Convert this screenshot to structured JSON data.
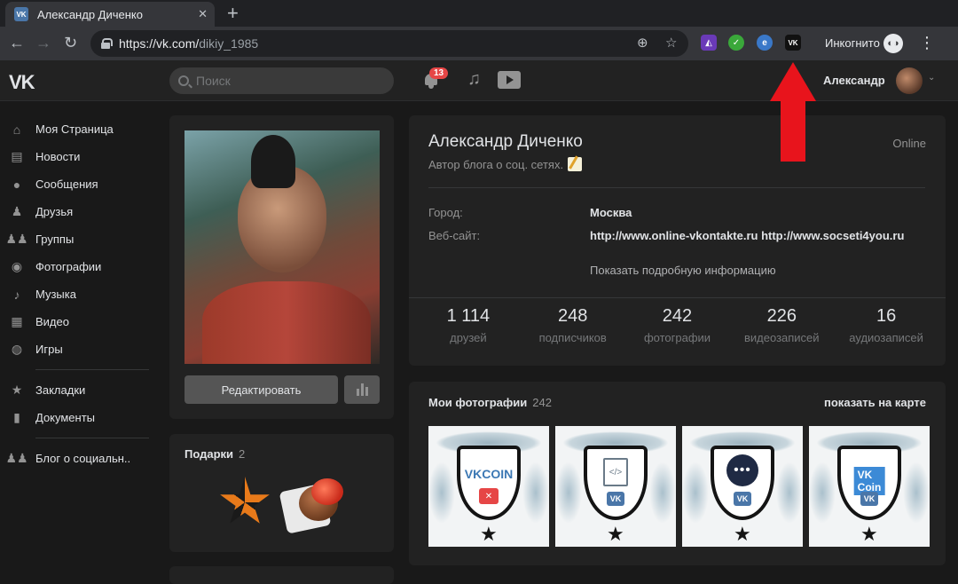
{
  "browser": {
    "tab_title": "Александр Диченко",
    "tab_favicon": "VK",
    "url_host": "https://vk.com/",
    "url_path": "dikiy_1985",
    "incognito_label": "Инкогнито",
    "extension_vk_label": "VK",
    "icons": [
      "back-icon",
      "forward-icon",
      "reload-icon",
      "lock-icon",
      "zoom-icon",
      "star-icon",
      "incognito-icon",
      "menu-icon"
    ]
  },
  "header": {
    "logo": "VK",
    "search_placeholder": "Поиск",
    "notification_count": "13",
    "user_name": "Александр"
  },
  "sidebar": {
    "items": [
      {
        "label": "Моя Страница",
        "icon": "home-icon"
      },
      {
        "label": "Новости",
        "icon": "news-icon"
      },
      {
        "label": "Сообщения",
        "icon": "messages-icon"
      },
      {
        "label": "Друзья",
        "icon": "friends-icon"
      },
      {
        "label": "Группы",
        "icon": "groups-icon"
      },
      {
        "label": "Фотографии",
        "icon": "camera-icon"
      },
      {
        "label": "Музыка",
        "icon": "music-icon"
      },
      {
        "label": "Видео",
        "icon": "video-icon"
      },
      {
        "label": "Игры",
        "icon": "gamepad-icon"
      }
    ],
    "items2": [
      {
        "label": "Закладки",
        "icon": "bookmark-icon"
      },
      {
        "label": "Документы",
        "icon": "document-icon"
      }
    ],
    "items3": [
      {
        "label": "Блог о социальн..",
        "icon": "community-icon"
      }
    ]
  },
  "profile": {
    "edit_button": "Редактировать",
    "name": "Александр Диченко",
    "status": "Автор блога о соц. сетях.",
    "online": "Online",
    "city_label": "Город:",
    "city_value": "Москва",
    "website_label": "Веб-сайт:",
    "website_value": "http://www.online-vkontakte.ru http://www.socseti4you.ru",
    "more_info": "Показать подробную информацию",
    "counters": [
      {
        "num": "1 114",
        "label": "друзей"
      },
      {
        "num": "248",
        "label": "подписчиков"
      },
      {
        "num": "242",
        "label": "фотографии"
      },
      {
        "num": "226",
        "label": "видеозаписей"
      },
      {
        "num": "16",
        "label": "аудиозаписей"
      }
    ]
  },
  "gifts": {
    "title": "Подарки",
    "count": "2"
  },
  "photos": {
    "title": "Мои фотографии",
    "count": "242",
    "map_link": "показать на карте",
    "thumbs": [
      {
        "emblem": "VKCOIN"
      },
      {
        "emblem": "</>"
      },
      {
        "emblem": "•••"
      },
      {
        "emblem": "VK Coin"
      }
    ]
  },
  "colors": {
    "background": "#191919",
    "card": "#222222",
    "arrow": "#e8141c",
    "badge": "#e64646",
    "vk_blue": "#4a76a8"
  }
}
